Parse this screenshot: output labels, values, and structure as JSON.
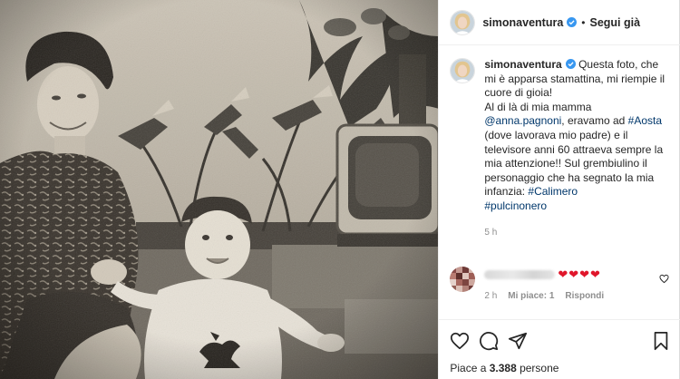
{
  "post": {
    "username": "simonaventura",
    "follow_label": "Segui già",
    "separator": "•"
  },
  "caption": {
    "username": "simonaventura",
    "text_1": "Questa foto, che mi è apparsa stamattina, mi riempie il cuore di gioia!",
    "text_2": "Al di là di mia mamma ",
    "mention": "@anna.pagnoni",
    "text_3": ", eravamo ad ",
    "hashtag_aosta": "#Aosta",
    "text_4": " (dove lavorava mio padre) e il televisore anni 60 attraeva sempre la mia attenzione!! Sul grembiulino il personaggio che ha segnato la mia infanzia: ",
    "hashtag_calimero": "#Calimero",
    "hashtag_pulcinonero": "#pulcinonero",
    "time": "5 h"
  },
  "comment": {
    "hearts": "❤❤❤❤",
    "time": "2 h",
    "likes": "Mi piace: 1",
    "reply": "Rispondi"
  },
  "actions": {
    "likes_prefix": "Piace a ",
    "likes_count": "3.388",
    "likes_suffix": " persone"
  },
  "icons": {
    "like": "heart-outline-icon",
    "comment": "comment-bubble-icon",
    "share": "paper-plane-icon",
    "save": "bookmark-icon",
    "verified": "verified-badge-icon"
  },
  "colors": {
    "verified": "#3897f0",
    "link": "#00376b",
    "heart": "#e0162b",
    "muted": "#8e8e8e"
  }
}
